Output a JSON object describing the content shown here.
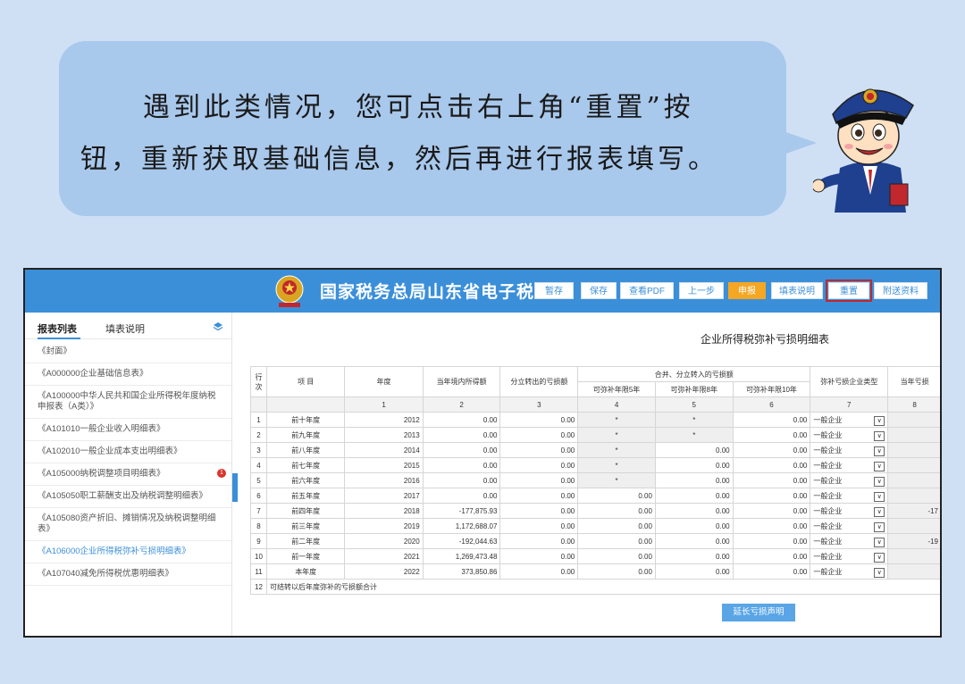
{
  "bubble": {
    "line1": "遇到此类情况，您可点击右上角“重置”按",
    "line2": "钮，重新获取基础信息，然后再进行报表填写。"
  },
  "app": {
    "title": "国家税务总局山东省电子税",
    "toolbar": [
      "暂存",
      "保存",
      "查看PDF",
      "上一步",
      "申报",
      "填表说明",
      "重置",
      "附送资料"
    ]
  },
  "sidebar": {
    "tabs": [
      "报表列表",
      "填表说明"
    ],
    "items": [
      "《封面》",
      "《A000000企业基础信息表》",
      "《A100000中华人民共和国企业所得税年度纳税申报表（A类）》",
      "《A101010一般企业收入明细表》",
      "《A102010一般企业成本支出明细表》",
      "《A105000纳税调整项目明细表》",
      "《A105050职工薪酬支出及纳税调整明细表》",
      "《A105080资产折旧、摊销情况及纳税调整明细表》",
      "《A106000企业所得税弥补亏损明细表》",
      "《A107040减免所得税优惠明细表》"
    ],
    "badge": "1"
  },
  "report": {
    "title": "企业所得税弥补亏损明细表",
    "headers": {
      "row_no": "行次",
      "item": "项 目",
      "year": "年度",
      "income": "当年境内所得额",
      "split_out": "分立转出的亏损额",
      "merge_group": "合并、分立转入的亏损额",
      "y5": "可弥补年限5年",
      "y8": "可弥补年限8年",
      "y10": "可弥补年限10年",
      "type": "弥补亏损企业类型",
      "cur": "当年亏损"
    },
    "col_numbers": [
      "1",
      "2",
      "3",
      "4",
      "5",
      "6",
      "7",
      "8"
    ],
    "rows": [
      {
        "no": "1",
        "item": "前十年度",
        "year": "2012",
        "income": "0.00",
        "split": "0.00",
        "c4": "*",
        "c5": "*",
        "c6": "0.00",
        "type": "一般企业",
        "c8": ""
      },
      {
        "no": "2",
        "item": "前九年度",
        "year": "2013",
        "income": "0.00",
        "split": "0.00",
        "c4": "*",
        "c5": "*",
        "c6": "0.00",
        "type": "一般企业",
        "c8": ""
      },
      {
        "no": "3",
        "item": "前八年度",
        "year": "2014",
        "income": "0.00",
        "split": "0.00",
        "c4": "*",
        "c5": "0.00",
        "c6": "0.00",
        "type": "一般企业",
        "c8": ""
      },
      {
        "no": "4",
        "item": "前七年度",
        "year": "2015",
        "income": "0.00",
        "split": "0.00",
        "c4": "*",
        "c5": "0.00",
        "c6": "0.00",
        "type": "一般企业",
        "c8": ""
      },
      {
        "no": "5",
        "item": "前六年度",
        "year": "2016",
        "income": "0.00",
        "split": "0.00",
        "c4": "*",
        "c5": "0.00",
        "c6": "0.00",
        "type": "一般企业",
        "c8": ""
      },
      {
        "no": "6",
        "item": "前五年度",
        "year": "2017",
        "income": "0.00",
        "split": "0.00",
        "c4": "0.00",
        "c5": "0.00",
        "c6": "0.00",
        "type": "一般企业",
        "c8": ""
      },
      {
        "no": "7",
        "item": "前四年度",
        "year": "2018",
        "income": "-177,875.93",
        "split": "0.00",
        "c4": "0.00",
        "c5": "0.00",
        "c6": "0.00",
        "type": "一般企业",
        "c8": "-17"
      },
      {
        "no": "8",
        "item": "前三年度",
        "year": "2019",
        "income": "1,172,688.07",
        "split": "0.00",
        "c4": "0.00",
        "c5": "0.00",
        "c6": "0.00",
        "type": "一般企业",
        "c8": ""
      },
      {
        "no": "9",
        "item": "前二年度",
        "year": "2020",
        "income": "-192,044.63",
        "split": "0.00",
        "c4": "0.00",
        "c5": "0.00",
        "c6": "0.00",
        "type": "一般企业",
        "c8": "-19"
      },
      {
        "no": "10",
        "item": "前一年度",
        "year": "2021",
        "income": "1,269,473.48",
        "split": "0.00",
        "c4": "0.00",
        "c5": "0.00",
        "c6": "0.00",
        "type": "一般企业",
        "c8": ""
      },
      {
        "no": "11",
        "item": "本年度",
        "year": "2022",
        "income": "373,850.86",
        "split": "0.00",
        "c4": "0.00",
        "c5": "0.00",
        "c6": "0.00",
        "type": "一般企业",
        "c8": ""
      }
    ],
    "row12": {
      "no": "12",
      "label": "可结转以后年度弥补的亏损额合计"
    },
    "extend_button": "延长亏损声明"
  }
}
